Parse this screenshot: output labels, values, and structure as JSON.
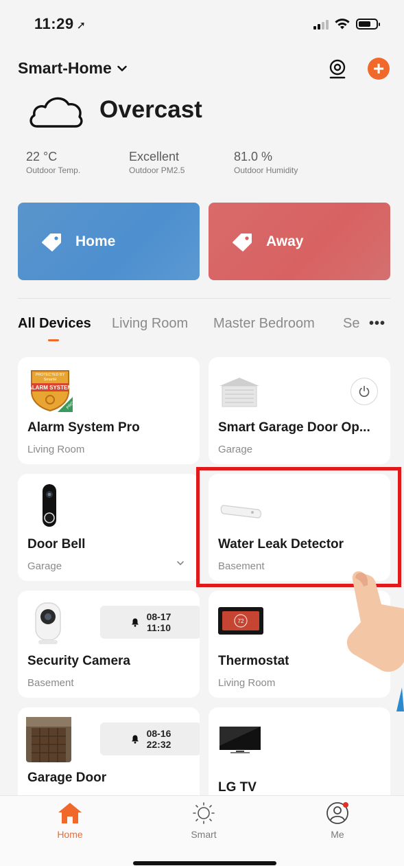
{
  "status_bar": {
    "time": "11:29"
  },
  "header": {
    "home_name": "Smart-Home"
  },
  "weather": {
    "condition": "Overcast",
    "stats": [
      {
        "value": "22 °C",
        "label": "Outdoor Temp."
      },
      {
        "value": "Excellent",
        "label": "Outdoor PM2.5"
      },
      {
        "value": "81.0 %",
        "label": "Outdoor Humidity"
      }
    ]
  },
  "scenes": [
    {
      "label": "Home",
      "color": "#4d8fcf"
    },
    {
      "label": "Away",
      "color": "#d86262"
    }
  ],
  "tabs": [
    {
      "label": "All Devices",
      "active": true
    },
    {
      "label": "Living Room"
    },
    {
      "label": "Master Bedroom"
    },
    {
      "label": "Se"
    }
  ],
  "devices": [
    {
      "name": "Alarm System Pro",
      "room": "Living Room",
      "badge_line1": "PROTECTED BY",
      "badge_line2": "SmartH",
      "badge_main": "ALARM SYSTEM",
      "badge_corner": "PRO"
    },
    {
      "name": "Smart Garage Door Op...",
      "room": "Garage",
      "icon": "power-icon"
    },
    {
      "name": "Door Bell",
      "room": "Garage",
      "icon": "chevron-down-icon"
    },
    {
      "name": "Water Leak Detector",
      "room": "Basement"
    },
    {
      "name": "Security Camera",
      "room": "Basement",
      "alert_date": "08-17",
      "alert_time": "11:10"
    },
    {
      "name": "Thermostat",
      "room": "Living Room",
      "display_value": "72"
    },
    {
      "name": "Garage Door",
      "room": "",
      "alert_date": "08-16",
      "alert_time": "22:32"
    },
    {
      "name": "LG TV",
      "room": ""
    }
  ],
  "bottom_nav": [
    {
      "label": "Home",
      "active": true
    },
    {
      "label": "Smart"
    },
    {
      "label": "Me"
    }
  ],
  "colors": {
    "accent": "#f0682a",
    "highlight": "#e01a1a"
  }
}
